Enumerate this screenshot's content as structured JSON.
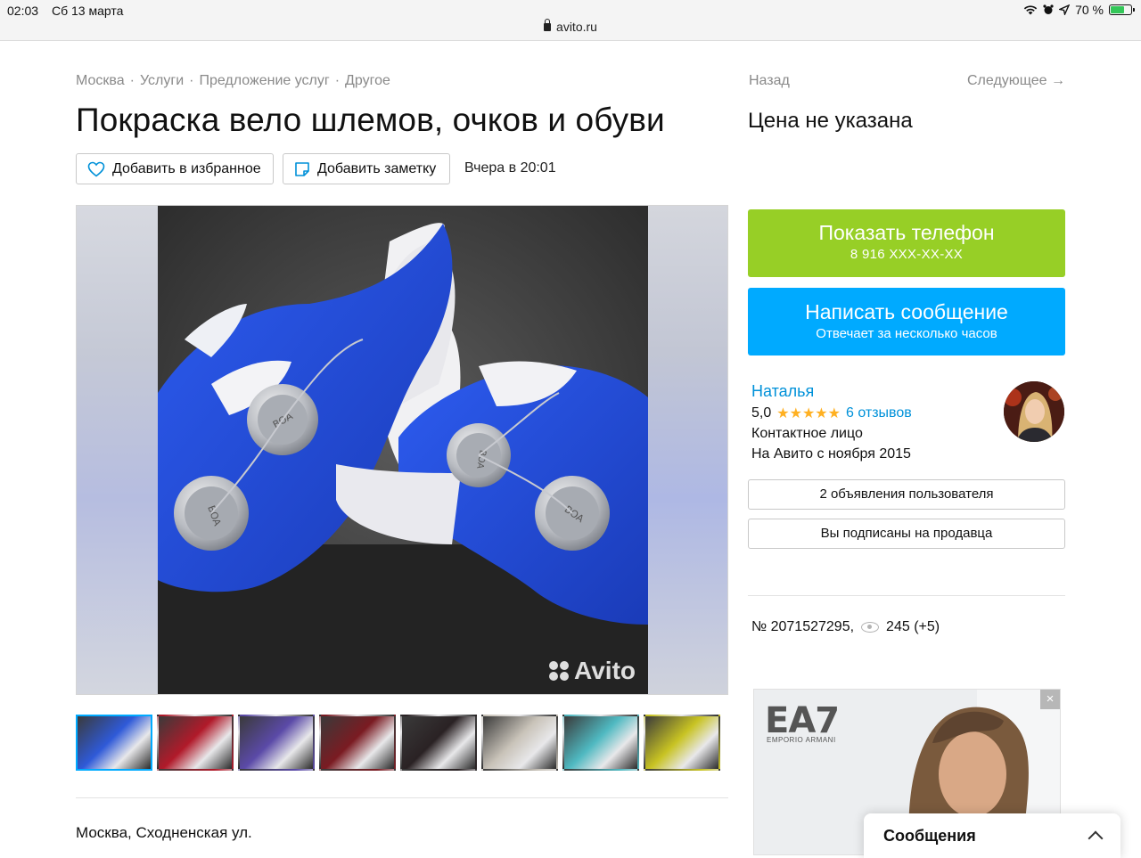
{
  "status_bar": {
    "time": "02:03",
    "date": "Сб 13 марта",
    "battery": "70 %",
    "url": "avito.ru"
  },
  "breadcrumb": [
    "Москва",
    "Услуги",
    "Предложение услуг",
    "Другое"
  ],
  "nav": {
    "back": "Назад",
    "next": "Следующее →"
  },
  "listing": {
    "title": "Покраска вело шлемов, очков и обуви",
    "price": "Цена не указана",
    "favorite_label": "Добавить в избранное",
    "note_label": "Добавить заметку",
    "posted": "Вчера в 20:01",
    "watermark": "Avito",
    "address": "Москва, Сходненская ул.",
    "id_text": "№ 2071527295,",
    "views": "245 (+5)"
  },
  "thumbnails": [
    {
      "name": "thumb-blue-shoes",
      "color": "#2f5ad8"
    },
    {
      "name": "thumb-red-shoes",
      "color": "#b11a2a"
    },
    {
      "name": "thumb-purple-shoes",
      "color": "#5b4aa8"
    },
    {
      "name": "thumb-red-helmet",
      "color": "#7a1b22"
    },
    {
      "name": "thumb-black-helmet",
      "color": "#2a2224"
    },
    {
      "name": "thumb-white-shoes",
      "color": "#c9c3b9"
    },
    {
      "name": "thumb-teal-shoes",
      "color": "#4fb9c1"
    },
    {
      "name": "thumb-yellow-glasses",
      "color": "#c8c323"
    }
  ],
  "contact": {
    "phone_label": "Показать телефон",
    "phone_number": "8 916 XXX-XX-XX",
    "message_label": "Написать сообщение",
    "message_sub": "Отвечает за несколько часов"
  },
  "seller": {
    "name": "Наталья",
    "rating": "5,0",
    "stars": "★★★★★",
    "reviews": "6 отзывов",
    "role": "Контактное лицо",
    "since": "На Авито с ноября 2015",
    "ads_button": "2 объявления пользователя",
    "subscribe_button": "Вы подписаны на продавца"
  },
  "banner": {
    "brand": "EA7",
    "brand_sub": "EMPORIO ARMANI",
    "close": "×"
  },
  "messages_widget": {
    "label": "Сообщения"
  },
  "colors": {
    "phone_green": "#97cf26",
    "message_blue": "#00aaff",
    "link_blue": "#0091d9",
    "star_yellow": "#ffb021"
  }
}
